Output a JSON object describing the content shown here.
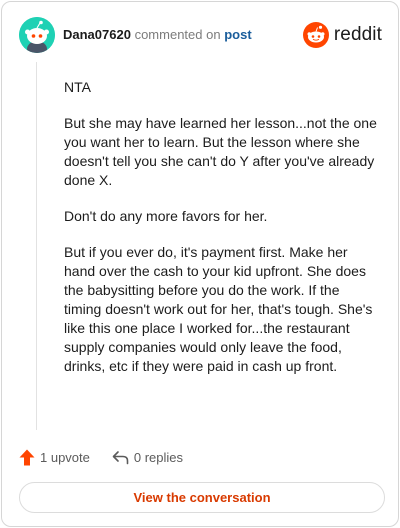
{
  "comment": {
    "username": "Dana07620",
    "action_text": "commented on",
    "post_link": "post",
    "brand": "reddit",
    "paragraphs": [
      "NTA",
      "But she may have learned her lesson...not the one you want her to learn. But the lesson where she doesn't tell you she can't do Y after you've already done X.",
      "Don't do any more favors for her.",
      "But if you ever do, it's payment first. Make her hand over the cash to your kid upfront. She does the babysitting before you do the work. If the timing doesn't work out for her, that's tough. She's like this one place I worked for...the restaurant supply companies would only leave the food, drinks, etc if they were paid in cash up front."
    ],
    "upvotes_label": "1 upvote",
    "replies_label": "0 replies",
    "view_conversation_label": "View the conversation"
  },
  "colors": {
    "brand_orange": "#ff4500",
    "link_blue": "#1a5d9b",
    "button_text": "#d93a00",
    "avatar_bg": "#1fd1b4"
  },
  "icons": [
    "snoo-avatar-icon",
    "reddit-logo-icon",
    "upvote-arrow-icon",
    "reply-arrow-icon"
  ]
}
